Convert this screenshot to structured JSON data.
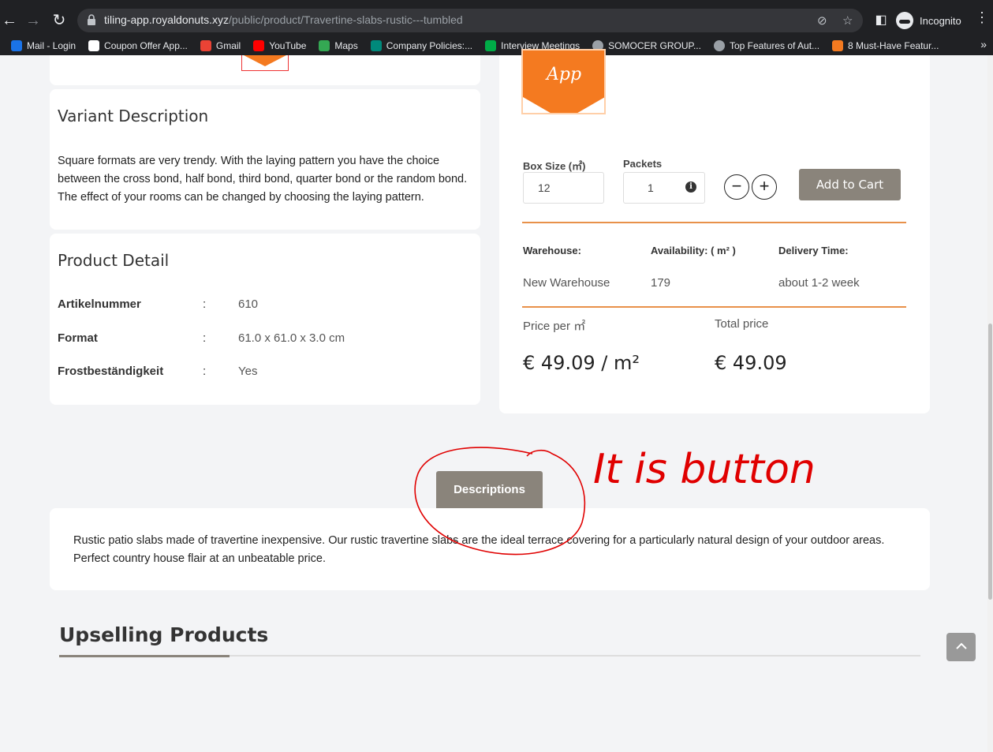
{
  "browser": {
    "url_host": "tiling-app.royaldonuts.xyz",
    "url_path": "/public/product/Travertine-slabs-rustic---tumbled",
    "incognito_label": "Incognito",
    "bookmarks": [
      {
        "label": "Mail - Login",
        "icon": "mail-icon",
        "color": "#1a73e8"
      },
      {
        "label": "Coupon Offer App...",
        "icon": "coupon-icon",
        "color": "#ffffff"
      },
      {
        "label": "Gmail",
        "icon": "gmail-icon",
        "color": "#ea4335"
      },
      {
        "label": "YouTube",
        "icon": "youtube-icon",
        "color": "#ff0000"
      },
      {
        "label": "Maps",
        "icon": "maps-icon",
        "color": "#34a853"
      },
      {
        "label": "Company Policies:...",
        "icon": "company-icon",
        "color": "#00897b"
      },
      {
        "label": "Interview Meetings",
        "icon": "meet-icon",
        "color": "#00ac47"
      },
      {
        "label": "SOMOCER GROUP...",
        "icon": "globe-icon",
        "color": "#9aa0a6"
      },
      {
        "label": "Top Features of Aut...",
        "icon": "globe-icon",
        "color": "#9aa0a6"
      },
      {
        "label": "8 Must-Have Featur...",
        "icon": "article-icon",
        "color": "#f47a20"
      }
    ]
  },
  "variant": {
    "title": "Variant Description",
    "text": "Square formats are very trendy. With the laying pattern you have the choice between the cross bond, half bond, third bond, quarter bond or the random bond. The effect of your rooms can be changed by choosing the laying pattern."
  },
  "detail": {
    "title": "Product Detail",
    "rows": [
      {
        "label": "Artikelnummer",
        "colon": ":",
        "value": "610"
      },
      {
        "label": "Format",
        "colon": ":",
        "value": "61.0 x 61.0 x 3.0 cm"
      },
      {
        "label": "Frostbeständigkeit",
        "colon": ":",
        "value": "Yes"
      }
    ]
  },
  "logo": {
    "text": "App",
    "color": "#f47a20"
  },
  "order": {
    "box_size_label": "Box Size (㎡)",
    "box_size_value": "12",
    "packets_label": "Packets",
    "packets_value": "1",
    "minus": "−",
    "plus": "+",
    "add_to_cart": "Add to Cart"
  },
  "warehouse": {
    "head_warehouse": "Warehouse:",
    "head_availability": "Availability: ( m² )",
    "head_delivery": "Delivery Time:",
    "warehouse": "New Warehouse",
    "availability": "179",
    "delivery": "about 1-2 week"
  },
  "price": {
    "per_label": "Price per ㎡",
    "total_label": "Total price",
    "per_value": "€ 49.09 / m²",
    "total_value": "€ 49.09"
  },
  "tabs": {
    "descriptions": "Descriptions"
  },
  "description": "Rustic patio slabs made of travertine inexpensive. Our rustic travertine slabs are the ideal terrace covering for a particularly natural design of your outdoor areas. Perfect country house flair at an unbeatable price.",
  "upsell": {
    "title": "Upselling Products"
  },
  "annotation_text": "It is button",
  "colors": {
    "accent_button": "#8a847b",
    "orange_line": "#e8914a",
    "annotation_red": "#e00000"
  }
}
